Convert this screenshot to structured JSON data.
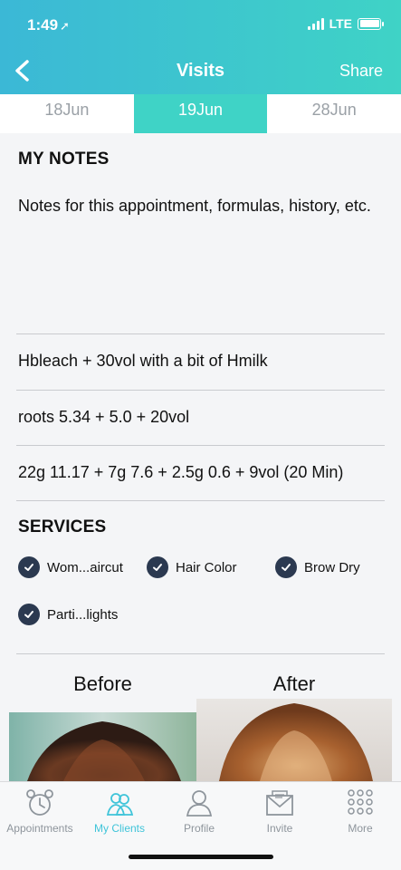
{
  "status_bar": {
    "time": "1:49",
    "network": "LTE"
  },
  "nav": {
    "title": "Visits",
    "share_label": "Share"
  },
  "date_tabs": [
    {
      "label": "18Jun",
      "active": false
    },
    {
      "label": "19Jun",
      "active": true
    },
    {
      "label": "28Jun",
      "active": false
    }
  ],
  "notes": {
    "heading": "MY NOTES",
    "text": "Notes for this appointment, formulas, history, etc.",
    "lines": [
      "Hbleach + 30vol with a bit of Hmilk",
      "roots 5.34 + 5.0 + 20vol",
      "22g 11.17 + 7g 7.6 + 2.5g 0.6 + 9vol (20 Min)"
    ]
  },
  "services": {
    "heading": "SERVICES",
    "items": [
      "Wom...aircut",
      "Hair Color",
      "Brow Dry",
      "Parti...lights"
    ]
  },
  "photos": {
    "before_label": "Before",
    "after_label": "After"
  },
  "tabbar": {
    "items": [
      {
        "label": "Appointments",
        "icon": "alarm-clock-icon",
        "active": false
      },
      {
        "label": "My Clients",
        "icon": "clients-icon",
        "active": true
      },
      {
        "label": "Profile",
        "icon": "profile-icon",
        "active": false
      },
      {
        "label": "Invite",
        "icon": "envelope-icon",
        "active": false
      },
      {
        "label": "More",
        "icon": "grid-dots-icon",
        "active": false
      }
    ]
  },
  "colors": {
    "accent": "#3fd3c6",
    "header_gradient_start": "#3bb8d6",
    "check": "#2b3950",
    "tab_active": "#3fc4d9"
  }
}
